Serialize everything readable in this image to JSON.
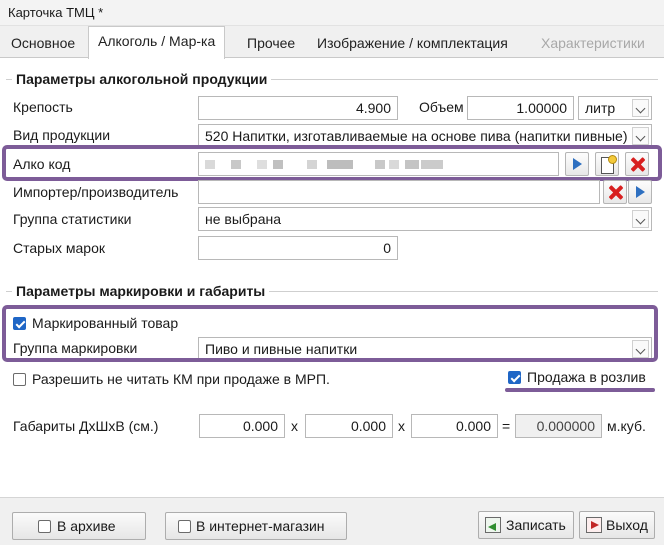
{
  "window": {
    "title": "Карточка ТМЦ *"
  },
  "tabs": [
    {
      "label": "Основное"
    },
    {
      "label": "Алкоголь / Мар-ка"
    },
    {
      "label": "Прочее"
    },
    {
      "label": "Изображение / комплектация"
    },
    {
      "label": "Характеристики"
    }
  ],
  "alcohol_section": {
    "title": "Параметры алкогольной продукции",
    "strength_label": "Крепость",
    "strength_value": "4.900",
    "volume_label": "Объем",
    "volume_value": "1.00000",
    "unit_value": "литр",
    "product_type_label": "Вид продукции",
    "product_type_value": "520 Напитки, изготавливаемые на основе пива (напитки пивные)",
    "alco_code_label": "Алко код",
    "importer_label": "Импортер/производитель",
    "stat_group_label": "Группа статистики",
    "stat_group_value": "не выбрана",
    "old_stamps_label": "Старых марок",
    "old_stamps_value": "0"
  },
  "marking_section": {
    "title": "Параметры маркировки и габариты",
    "marked_label": "Маркированный товар",
    "marked_checked": true,
    "marking_group_label": "Группа маркировки",
    "marking_group_value": "Пиво и пивные напитки",
    "allow_no_km_label": "Разрешить не читать КМ при продаже в МРП.",
    "allow_no_km_checked": false,
    "draft_sale_label": "Продажа в розлив",
    "draft_sale_checked": true,
    "dimensions_label": "Габариты ДхШхВ (см.)",
    "dim_length": "0.000",
    "dim_width": "0.000",
    "dim_height": "0.000",
    "times_sign": "x",
    "equals_sign": "=",
    "volume_result": "0.000000",
    "volume_unit": "м.куб."
  },
  "footer": {
    "archive_label": "В архиве",
    "archive_checked": false,
    "online_store_label": "В интернет-магазин",
    "online_store_checked": false,
    "save_label": "Записать",
    "exit_label": "Выход"
  },
  "colors": {
    "highlight": "#7d5c98",
    "checkbox_checked": "#1f66c6",
    "delete_red": "#d82020",
    "play_blue": "#2d6fc0"
  }
}
